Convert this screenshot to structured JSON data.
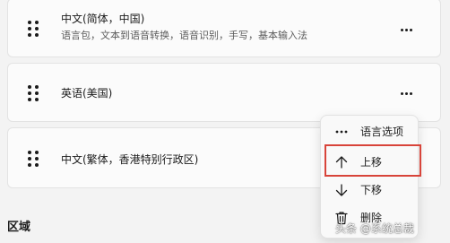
{
  "languages": [
    {
      "title": "中文(简体，中国)",
      "subtitle": "语言包，文本到语音转换，语音识别，手写，基本输入法"
    },
    {
      "title": "英语(美国)"
    },
    {
      "title": "中文(繁体，香港特别行政区)"
    }
  ],
  "section": {
    "region_title": "区域"
  },
  "context_menu": {
    "items": [
      {
        "label": "语言选项",
        "icon": "more-horizontal-icon"
      },
      {
        "label": "上移",
        "icon": "arrow-up-icon"
      },
      {
        "label": "下移",
        "icon": "arrow-down-icon"
      },
      {
        "label": "删除",
        "icon": "trash-icon"
      }
    ],
    "highlight_color": "#d8443a"
  },
  "watermark": {
    "text": "头条 @系统总裁"
  }
}
